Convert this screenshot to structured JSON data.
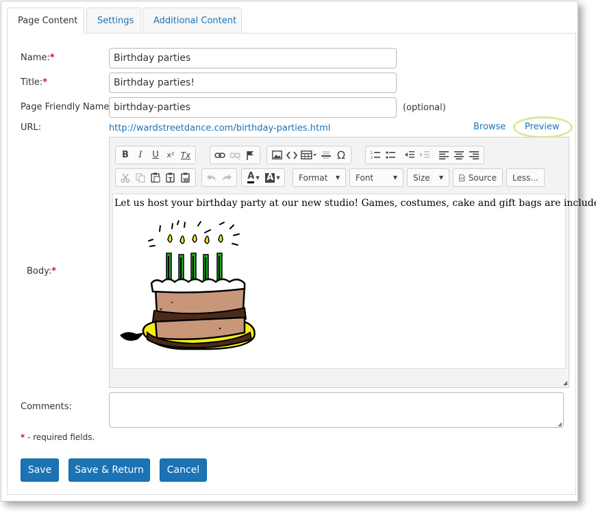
{
  "tabs": [
    {
      "label": "Page Content",
      "active": true
    },
    {
      "label": "Settings",
      "active": false
    },
    {
      "label": "Additional Content",
      "active": false
    }
  ],
  "form": {
    "name_label": "Name:",
    "name_value": "Birthday parties",
    "title_label": "Title:",
    "title_value": "Birthday parties!",
    "friendly_label": "Page Friendly Name:",
    "friendly_value": "birthday-parties",
    "optional_text": "(optional)",
    "url_label": "URL:",
    "url_value": "http://wardstreetdance.com/birthday-parties.html",
    "browse_label": "Browse",
    "preview_label": "Preview",
    "body_label": "Body:",
    "comments_label": "Comments:",
    "required_marker": "*",
    "required_note": " - required fields."
  },
  "editor": {
    "format_label": "Format",
    "font_label": "Font",
    "size_label": "Size",
    "source_label": "Source",
    "less_label": "Less...",
    "bold_glyph": "B",
    "italic_glyph": "I",
    "underline_glyph": "U",
    "superscript_glyph": "x²",
    "clear_format_glyph": "Tx",
    "text_color_glyph": "A",
    "bg_color_glyph": "A",
    "content_text": "Let us host your birthday party at our new studio!  Games, costumes, cake and gift bags are included."
  },
  "buttons": {
    "save": "Save",
    "save_return": "Save & Return",
    "cancel": "Cancel"
  },
  "colors": {
    "accent": "#1a73b5",
    "required": "#d9152a",
    "preview_highlight": "#d6ec93"
  }
}
